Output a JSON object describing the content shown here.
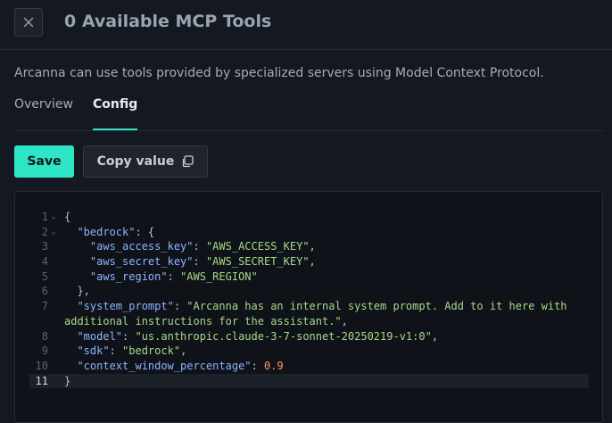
{
  "header": {
    "close_icon": "close-icon",
    "title": "0 Available MCP Tools"
  },
  "description": "Arcanna can use tools provided by specialized servers using Model Context Protocol.",
  "tabs": [
    {
      "label": "Overview",
      "active": false
    },
    {
      "label": "Config",
      "active": true
    }
  ],
  "actions": {
    "save_label": "Save",
    "copy_label": "Copy value",
    "copy_icon": "copy-icon"
  },
  "colors": {
    "accent": "#2ee6c6",
    "json_key": "#8ab6ff",
    "json_string": "#a7d98a",
    "json_number": "#ff9a5c"
  },
  "editor": {
    "active_line": 11,
    "lines": [
      {
        "num": "1",
        "fold": "⌄",
        "indent": "",
        "key": "",
        "value": "",
        "trail": "{"
      },
      {
        "num": "2",
        "fold": "⌄",
        "indent": "  ",
        "key": "\"bedrock\"",
        "value": "",
        "trail": ": {"
      },
      {
        "num": "3",
        "fold": "",
        "indent": "    ",
        "key": "\"aws_access_key\"",
        "value": "\"AWS_ACCESS_KEY\"",
        "trail": ","
      },
      {
        "num": "4",
        "fold": "",
        "indent": "    ",
        "key": "\"aws_secret_key\"",
        "value": "\"AWS_SECRET_KEY\"",
        "trail": ","
      },
      {
        "num": "5",
        "fold": "",
        "indent": "    ",
        "key": "\"aws_region\"",
        "value": "\"AWS_REGION\"",
        "trail": ""
      },
      {
        "num": "6",
        "fold": "",
        "indent": "  ",
        "key": "",
        "value": "",
        "trail": "},"
      },
      {
        "num": "7",
        "fold": "",
        "indent": "  ",
        "key": "\"system_prompt\"",
        "value": "\"Arcanna has an internal system prompt. Add to it here with additional instructions for the assistant.\"",
        "trail": ","
      },
      {
        "num": "8",
        "fold": "",
        "indent": "  ",
        "key": "\"model\"",
        "value": "\"us.anthropic.claude-3-7-sonnet-20250219-v1:0\"",
        "trail": ","
      },
      {
        "num": "9",
        "fold": "",
        "indent": "  ",
        "key": "\"sdk\"",
        "value": "\"bedrock\"",
        "trail": ","
      },
      {
        "num": "10",
        "fold": "",
        "indent": "  ",
        "key": "\"context_window_percentage\"",
        "value": "0.9",
        "trail": "",
        "number": true
      },
      {
        "num": "11",
        "fold": "",
        "indent": "",
        "key": "",
        "value": "",
        "trail": "}"
      }
    ]
  }
}
